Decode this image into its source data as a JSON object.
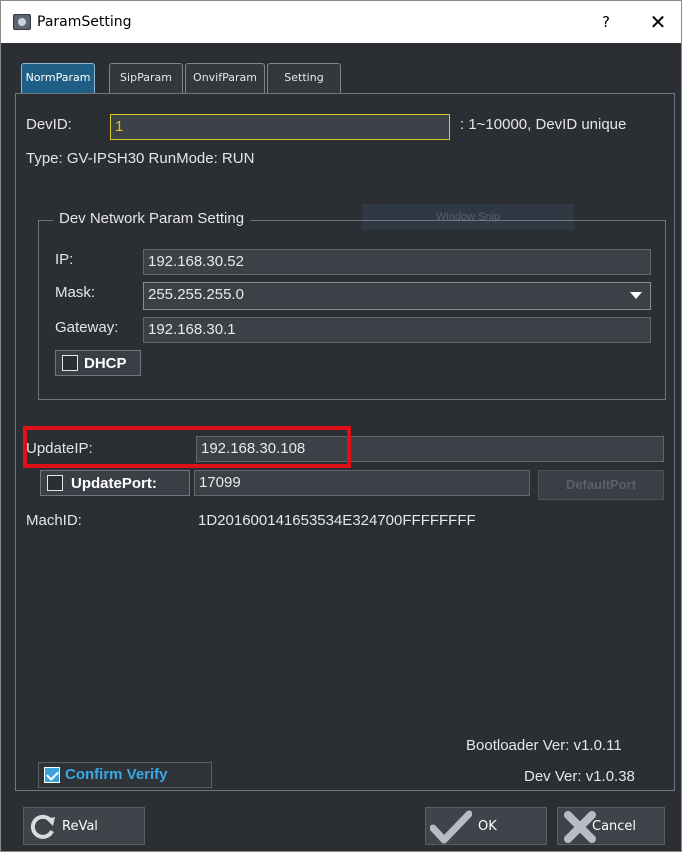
{
  "window": {
    "title": "ParamSetting",
    "help_label": "?",
    "close_label": "✕"
  },
  "tabs": [
    {
      "label": "NormParam",
      "active": true
    },
    {
      "label": "SipParam",
      "active": false
    },
    {
      "label": "OnvifParam",
      "active": false
    },
    {
      "label": "Setting",
      "active": false
    }
  ],
  "norm": {
    "devid_label": "DevID:",
    "devid_value": "1",
    "devid_hint": ": 1~10000, DevID unique",
    "type_text": "Type: GV-IPSH30 RunMode: RUN",
    "overlay_text": "Window Snip",
    "group_title": "Dev Network Param Setting",
    "ip_label": "IP:",
    "ip_value": "192.168.30.52",
    "mask_label": "Mask:",
    "mask_value": "255.255.255.0",
    "gateway_label": "Gateway:",
    "gateway_value": "192.168.30.1",
    "dhcp_label": "DHCP",
    "dhcp_checked": false,
    "update_ip_label": "UpdateIP:",
    "update_ip_value": "192.168.30.108",
    "update_port_label": "UpdatePort:",
    "update_port_checked": false,
    "update_port_value": "17099",
    "default_port_label": "DefaultPort",
    "mach_id_label": "MachID:",
    "mach_id_value": "1D201600141653534E324700FFFFFFFF",
    "bootloader_text": "Bootloader Ver:  v1.0.11",
    "dev_ver_text": "Dev Ver:  v1.0.38",
    "confirm_label": "Confirm Verify",
    "confirm_checked": true
  },
  "footer": {
    "reval_label": "ReVal",
    "ok_label": "OK",
    "cancel_label": "Cancel"
  },
  "colors": {
    "background": "#2b2e33",
    "active_tab": "#1f5f85",
    "devid_border": "#d8c62a",
    "highlight_box": "#e0101a",
    "confirm_text": "#3aa8e6",
    "ok_icon": "#b8bcc2"
  },
  "icons": {
    "app": "app-settings-icon",
    "reval": "refresh-icon",
    "ok": "checkmark-icon",
    "cancel": "x-icon",
    "mask_dropdown": "chevron-down-icon"
  }
}
